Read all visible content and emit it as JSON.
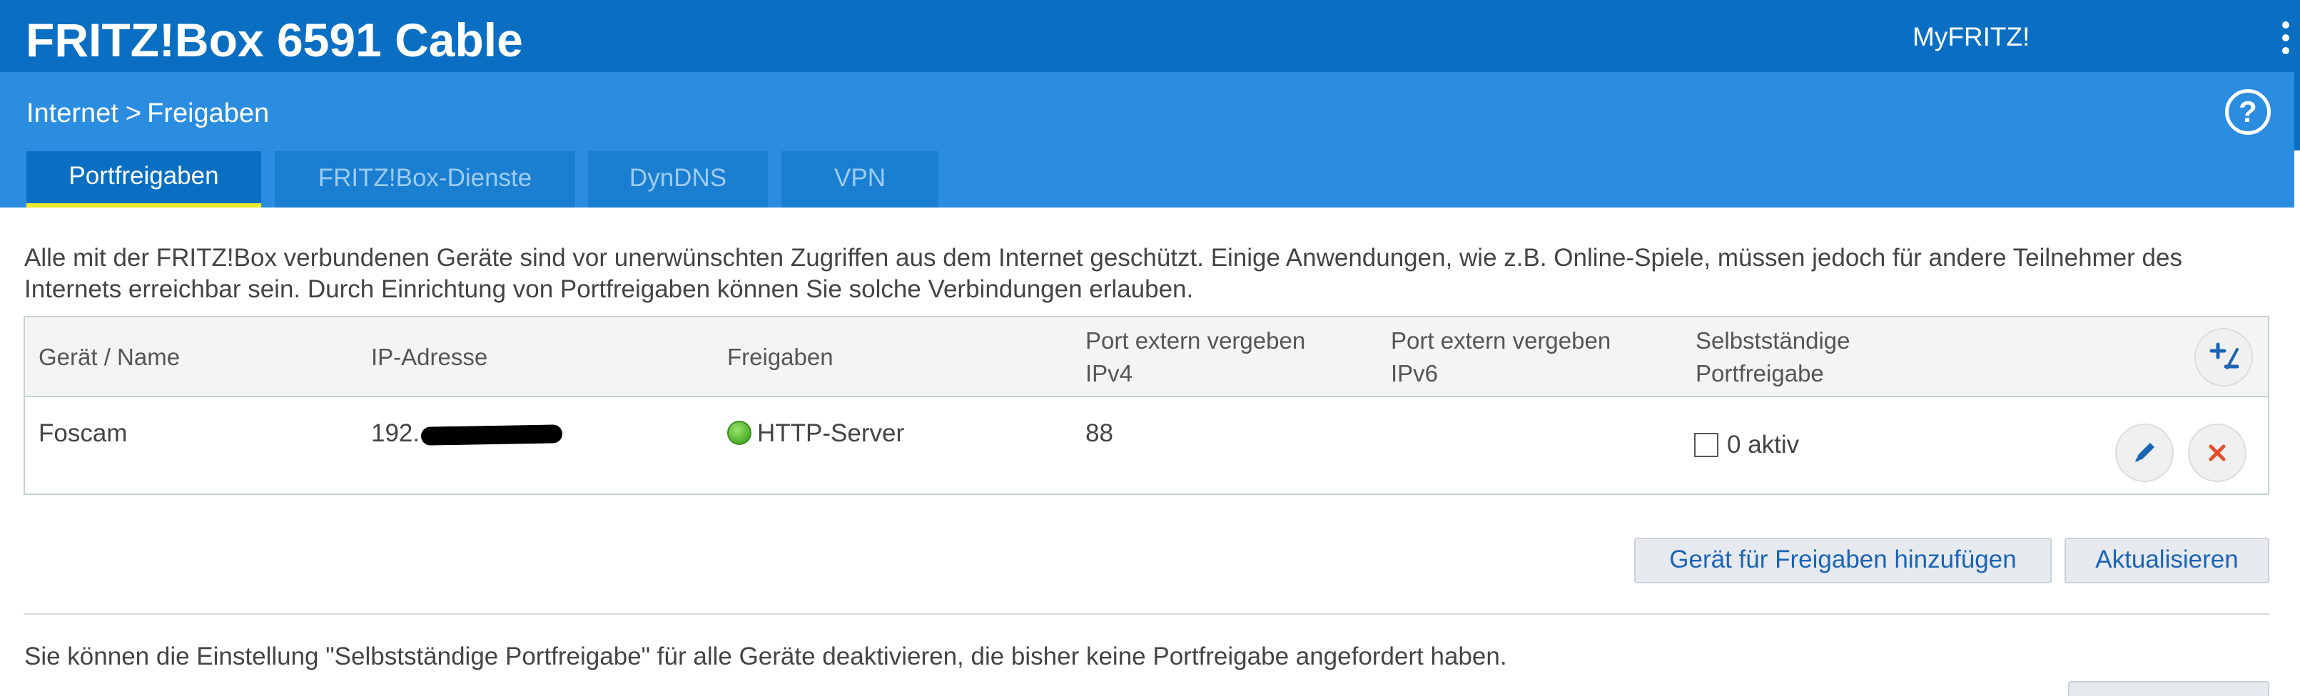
{
  "header": {
    "title": "FRITZ!Box 6591 Cable",
    "myfritz_label": "MyFRITZ!",
    "menu_icon": "vertical-dots-icon"
  },
  "breadcrumb": {
    "parent": "Internet",
    "separator": ">",
    "current": "Freigaben"
  },
  "help_icon": "question-circle-icon",
  "tabs": [
    {
      "label": "Portfreigaben",
      "active": true
    },
    {
      "label": "FRITZ!Box-Dienste",
      "active": false
    },
    {
      "label": "DynDNS",
      "active": false
    },
    {
      "label": "VPN",
      "active": false
    }
  ],
  "intro_text": "Alle mit der FRITZ!Box verbundenen Geräte sind vor unerwünschten Zugriffen aus dem Internet geschützt. Einige Anwendungen, wie z.B. Online-Spiele, müssen jedoch für andere Teilnehmer des Internets erreichbar sein. Durch Einrichtung von Portfreigaben können Sie solche Verbindungen erlauben.",
  "table": {
    "columns": [
      {
        "line1": "Gerät / Name",
        "line2": ""
      },
      {
        "line1": "IP-Adresse",
        "line2": ""
      },
      {
        "line1": "Freigaben",
        "line2": ""
      },
      {
        "line1": "Port extern vergeben",
        "line2": "IPv4"
      },
      {
        "line1": "Port extern vergeben",
        "line2": "IPv6"
      },
      {
        "line1": "Selbstständige",
        "line2": "Portfreigabe"
      }
    ],
    "expand_icon": "plus-minus-icon",
    "rows": [
      {
        "name": "Foscam",
        "ip_visible": "192.",
        "status_icon": "green-status-dot-icon",
        "freigaben": "HTTP-Server",
        "port_ipv4": "88",
        "port_ipv6": "",
        "selbst_checked": false,
        "selbst_label": "0 aktiv",
        "edit_icon": "pencil-icon",
        "delete_icon": "close-icon"
      }
    ]
  },
  "buttons": {
    "add_device": "Gerät für Freigaben hinzufügen",
    "refresh": "Aktualisieren"
  },
  "note_text": "Sie können die Einstellung \"Selbstständige Portfreigabe\" für alle Geräte deaktivieren, die bisher keine Portfreigabe angefordert haben.",
  "colors": {
    "header_bg": "#0a6fc2",
    "subheader_bg": "#2b8de0",
    "tab_active_underline": "#f0e82c",
    "link_blue": "#1c64b4",
    "delete_red": "#e4502b"
  }
}
